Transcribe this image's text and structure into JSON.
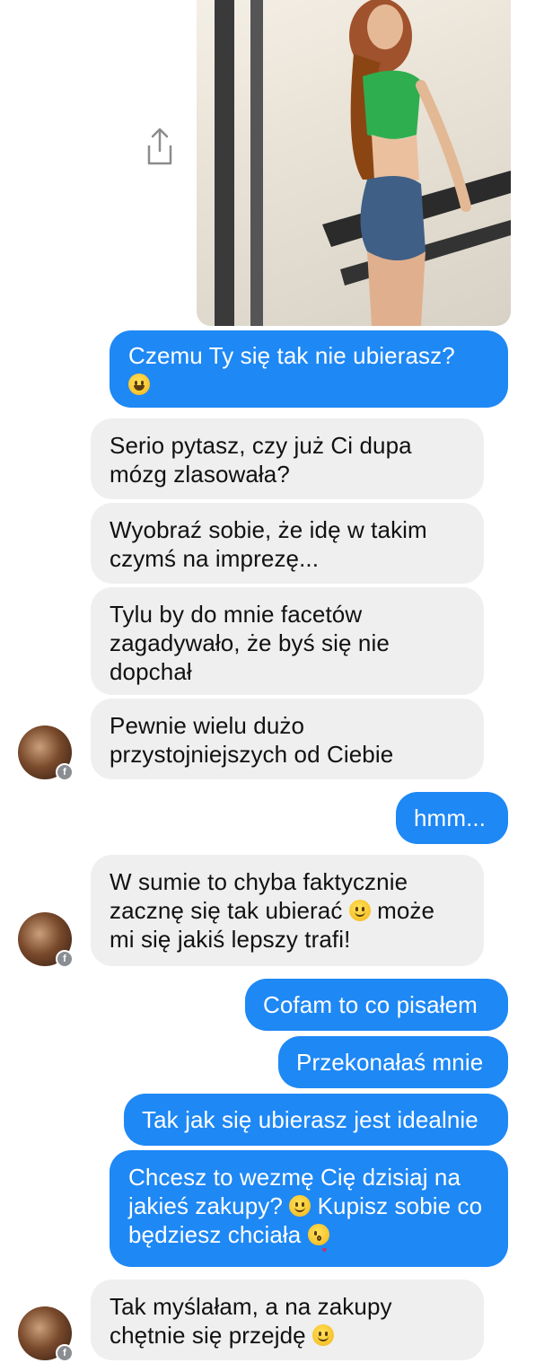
{
  "colors": {
    "outgoing": "#1e88f5",
    "incoming": "#efefef"
  },
  "photo": {
    "icon": "photo-image",
    "share_icon": "share-icon"
  },
  "messages": [
    {
      "dir": "out",
      "parts": [
        "Czemu Ty się tak nie ubierasz?",
        "😀"
      ]
    },
    {
      "dir": "in",
      "text": "Serio pytasz, czy już Ci dupa mózg zlasowała?"
    },
    {
      "dir": "in",
      "text": "Wyobraź sobie, że idę w takim czymś na imprezę..."
    },
    {
      "dir": "in",
      "text": "Tylu by do mnie facetów zagadywało, że byś się nie dopchał"
    },
    {
      "dir": "in",
      "text": "Pewnie wielu dużo przystojniejszych od Ciebie"
    },
    {
      "dir": "out",
      "text": "hmm..."
    },
    {
      "dir": "in",
      "parts": [
        "W sumie to chyba faktycznie zacznę się tak ubierać",
        "🙂",
        "może mi się jakiś lepszy trafi!"
      ]
    },
    {
      "dir": "out",
      "text": "Cofam to co pisałem"
    },
    {
      "dir": "out",
      "text": "Przekonałaś mnie"
    },
    {
      "dir": "out",
      "text": "Tak jak się ubierasz jest idealnie"
    },
    {
      "dir": "out",
      "parts": [
        "Chcesz to wezmę Cię dzisiaj na jakieś zakupy?",
        "🙂",
        "Kupisz sobie co będziesz chciała",
        "😘"
      ]
    },
    {
      "dir": "in",
      "parts": [
        "Tak myślałam, a na zakupy chętnie się przejdę",
        "🙂"
      ]
    }
  ]
}
